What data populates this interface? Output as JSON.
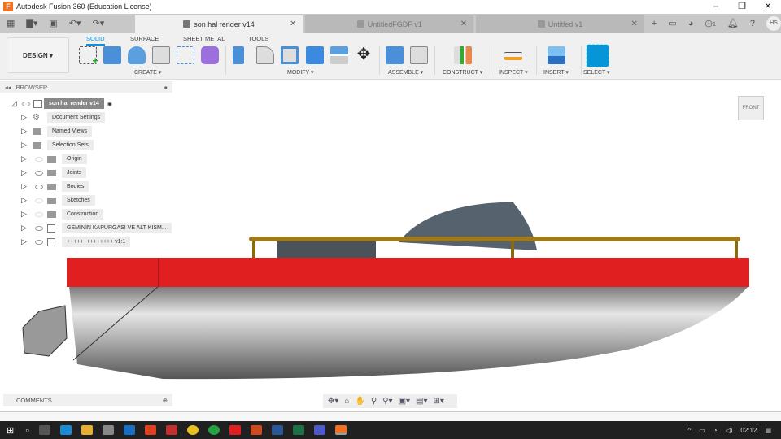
{
  "title": "Autodesk Fusion 360 (Education License)",
  "tabs": [
    {
      "label": "son hal render v14",
      "active": true
    },
    {
      "label": "UntitledFGDF v1"
    },
    {
      "label": "Untitled v1"
    }
  ],
  "user_initials": "HS",
  "job_count": "1",
  "workspace": "DESIGN",
  "toolbar_tabs": [
    "SOLID",
    "SURFACE",
    "SHEET METAL",
    "TOOLS"
  ],
  "groups": [
    "CREATE",
    "MODIFY",
    "ASSEMBLE",
    "CONSTRUCT",
    "INSPECT",
    "INSERT",
    "SELECT"
  ],
  "browser": {
    "title": "BROWSER",
    "root": "son hal render v14",
    "items": [
      "Document Settings",
      "Named Views",
      "Selection Sets",
      "Origin",
      "Joints",
      "Bodies",
      "Sketches",
      "Construction",
      "GEMİNİN KAPURGASİ VE ALT KISM...",
      "++++++++++++++ v1:1"
    ]
  },
  "viewcube": "FRONT",
  "comments": "COMMENTS",
  "clock": "02:12",
  "colors": {
    "accent": "#0696d7",
    "hull_red": "#e02020",
    "rail": "#a07a1a"
  }
}
